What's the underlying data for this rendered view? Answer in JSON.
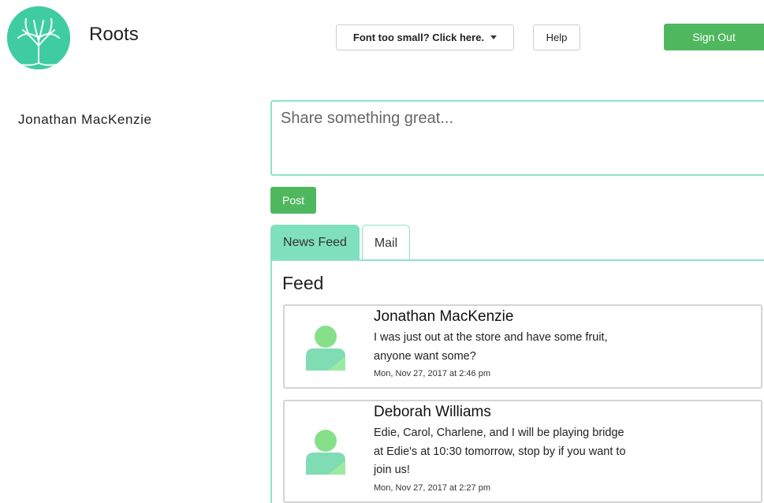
{
  "app": {
    "title": "Roots"
  },
  "header": {
    "font_button_label": "Font too small? Click here.",
    "help_label": "Help",
    "signout_label": "Sign Out"
  },
  "user": {
    "name": "Jonathan MacKenzie"
  },
  "composer": {
    "placeholder": "Share something great...",
    "post_label": "Post"
  },
  "tabs": [
    {
      "label": "News Feed",
      "active": true
    },
    {
      "label": "Mail",
      "active": false
    }
  ],
  "feed": {
    "title": "Feed",
    "posts": [
      {
        "author": "Jonathan MacKenzie",
        "lines": [
          "I was just out at the store and have some fruit,",
          "anyone want some?"
        ],
        "timestamp": "Mon, Nov 27, 2017 at 2:46 pm"
      },
      {
        "author": "Deborah Williams",
        "lines": [
          "Edie, Carol, Charlene, and I will be playing bridge",
          "at Edie's at 10:30 tomorrow, stop by if you want to",
          "join us!"
        ],
        "timestamp": "Mon, Nov 27, 2017 at 2:27 pm"
      }
    ]
  },
  "icons": {
    "logo": "tree-logo-icon",
    "avatar": "user-avatar-icon",
    "dropdown": "caret-down-icon"
  },
  "colors": {
    "accent": "#8ee4c4",
    "tab_active": "#7fe0bd",
    "button_green": "#4fb85f",
    "logo_bg": "#3fcca2"
  }
}
